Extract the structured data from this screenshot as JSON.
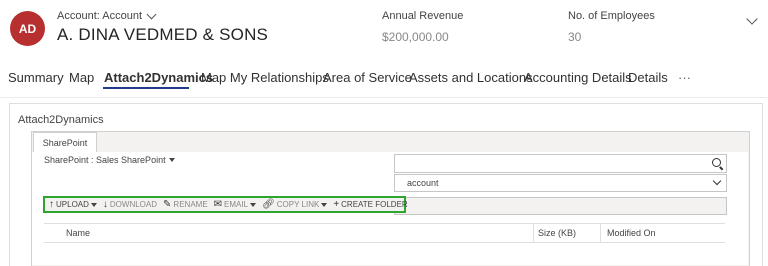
{
  "header": {
    "avatar_initials": "AD",
    "entity_label": "Account: Account",
    "account_name": "A. DINA VEDMED & SONS",
    "fields": [
      {
        "label": "Annual Revenue",
        "value": "$200,000.00"
      },
      {
        "label": "No. of Employees",
        "value": "30"
      }
    ]
  },
  "tabs": [
    "Summary",
    "Map",
    "Attach2Dynamics",
    "Map My Relationships",
    "Area of Service",
    "Assets and Locations",
    "Accounting Details",
    "Details",
    "···"
  ],
  "active_tab": "Attach2Dynamics",
  "section": {
    "title": "Attach2Dynamics",
    "panel_tab": "SharePoint",
    "sp_selector": "SharePoint : Sales SharePoint",
    "search_value": "",
    "dropdown_value": "account"
  },
  "toolbar": {
    "upload": "UPLOAD",
    "download": "DOWNLOAD",
    "rename": "RENAME",
    "email": "EMAIL",
    "copy_link": "COPY LINK",
    "create_folder": "CREATE FOLDER"
  },
  "table": {
    "columns": [
      "Name",
      "Size (KB)",
      "Modified On"
    ]
  },
  "colors": {
    "avatar": "#b72f2f",
    "active_tab_underline": "#1f3b8f",
    "toolbar_highlight": "#2ea52e"
  }
}
